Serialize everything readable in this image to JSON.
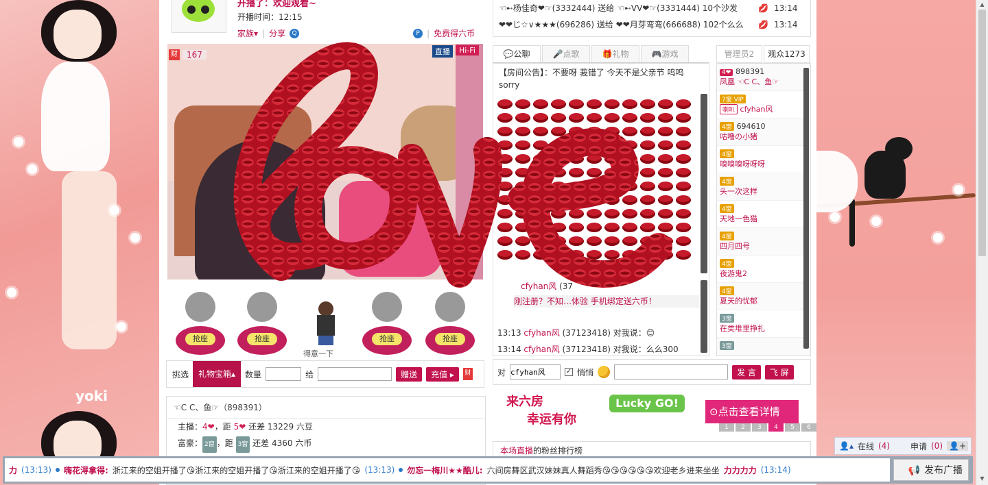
{
  "header": {
    "welcome": "开播了：欢迎观看~",
    "start_time": "开播时间：12:15",
    "links": [
      "家族▾",
      "分享",
      "免费得六币"
    ]
  },
  "video": {
    "live_label": "直播",
    "hifi_label": "Hi-Fi",
    "rank_count": "167"
  },
  "seats": {
    "btn": "抢座",
    "dancer_label": "得意一下"
  },
  "giftbar": {
    "pick": "挑选",
    "treasure": "礼物宝箱▴",
    "qty": "数量",
    "to": "给",
    "give": "赠送",
    "recharge": "充值 ▸"
  },
  "info": {
    "title": "☜C C、鱼☞（898391）",
    "host_label": "主播：",
    "host_text": "，距",
    "host_gap": "还差 13229 六豆",
    "rich_label": "富豪：",
    "rich_text": "，距",
    "rich_gap": "还差 4360 六币",
    "host_level": "4",
    "host_next": "5",
    "rich_level": "2窗",
    "rich_next": "3窗"
  },
  "gift_msgs": [
    {
      "text": "☜➸杨佳奇❤☞(3332444) 送给 ☜➸VV❤☞(3331444) 10个沙发",
      "time": "13:14"
    },
    {
      "text": "❤❤じ☆∨★★★(696286) 送给 ❤❤月芽弯弯(666688) 102个么么",
      "time": "13:14"
    }
  ],
  "chat_tabs": [
    "公聊",
    "点歌",
    "礼物",
    "游戏"
  ],
  "announcement": "【房间公告】：不要呀 莪错了 今天不是父亲节 呜呜 sorry",
  "chat_lines": [
    {
      "time": "",
      "name": "cfyhan风",
      "rest": "(37"
    },
    {
      "time": "",
      "name": "刚注册？不知",
      "rest": "…体验 手机绑定送六币！"
    },
    {
      "time": "13:13",
      "name": "cfyhan风",
      "rest": "(37123418)  对我说：😊"
    },
    {
      "time": "13:14",
      "name": "cfyhan风",
      "rest": "(37123418)  对我说：么么300"
    }
  ],
  "side_tabs": [
    "管理员2",
    "观众1273"
  ],
  "users": [
    {
      "rank": "4❤",
      "name": "898391",
      "sub": "凤凰 ☜C C、鱼☞"
    },
    {
      "rank": "7窗 VIP",
      "name": "cfyhan风",
      "sub": "喇叭"
    },
    {
      "rank": "4窗",
      "name": "694610",
      "sub": "咕噜の小猪"
    },
    {
      "rank": "4窗",
      "name": "嗅嗅嗅呀呀呀",
      "sub": ""
    },
    {
      "rank": "4窗",
      "name": "头一次这样",
      "sub": ""
    },
    {
      "rank": "4窗",
      "name": "天地一色猫",
      "sub": ""
    },
    {
      "rank": "4窗",
      "name": "四月四号",
      "sub": ""
    },
    {
      "rank": "4窗",
      "name": "夜游鬼2",
      "sub": ""
    },
    {
      "rank": "4窗",
      "name": "夏天的忧郁",
      "sub": ""
    },
    {
      "rank": "3窗",
      "name": "在类堆里挣扎",
      "sub": ""
    },
    {
      "rank": "3窗",
      "name": "",
      "sub": ""
    }
  ],
  "sendbar": {
    "to": "对",
    "target": "cfyhan风",
    "whisper": "悄悄",
    "send": "发 言",
    "fly": "飞 屏"
  },
  "banner": {
    "line1": "来六房",
    "line2": "幸运有你",
    "lucky": "Lucky GO!",
    "detail": "⊙点击查看详情",
    "pages": [
      "1",
      "2",
      "3",
      "4",
      "5",
      "6"
    ],
    "active_page": "4"
  },
  "fanrank": {
    "prefix": "本场直播",
    "suffix": "的粉丝排行榜"
  },
  "online": {
    "label": "在线",
    "count": "(4)",
    "apply": "申请",
    "apply_count": "(0)"
  },
  "ticker": {
    "lead": "力",
    "t1": "(13:13)",
    "u1": "嗨花淂拿得:",
    "m1": "浙江来的空姐开播了😘浙江来的空姐开播了😘浙江来的空姐开播了😘",
    "t2": "(13:13)",
    "u2": "勿忘一梅川★★酷儿:",
    "m2": "六间房舞区武汉妹妹真人舞蹈秀😘😘😘😘😘😘欢迎老乡进来坐坐",
    "tail": "力力力力",
    "t3": "(13:14)",
    "publish": "发布广播"
  },
  "colors": {
    "accent": "#c0104e",
    "love_red": "#b01020",
    "bg_pink": "#f4a9a9"
  }
}
